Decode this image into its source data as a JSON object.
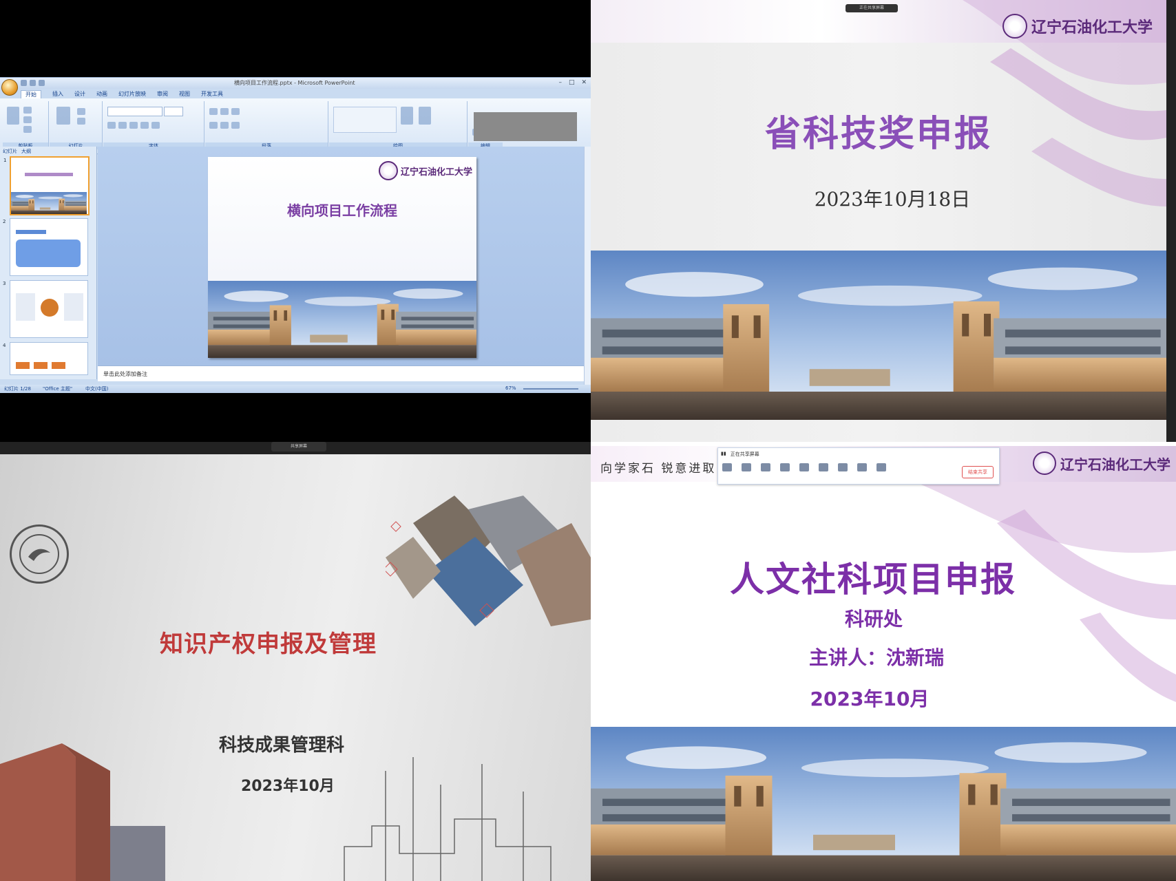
{
  "ppt": {
    "window_title": "横向项目工作流程.pptx - Microsoft PowerPoint",
    "ribbon_tabs": [
      "开始",
      "插入",
      "设计",
      "动画",
      "幻灯片放映",
      "审阅",
      "视图",
      "开发工具"
    ],
    "ribbon_groups": [
      "剪贴板",
      "幻灯片",
      "字体",
      "段落",
      "绘图",
      "编辑"
    ],
    "pane_tabs": [
      "幻灯片",
      "大纲"
    ],
    "slide_title": "横向项目工作流程",
    "university_logo": "辽宁石油化工大学",
    "notes_placeholder": "单击此处添加备注",
    "status_left": "幻灯片 1/28",
    "status_mid": "\"Office 主题\"",
    "status_lang": "中文(中国)",
    "zoom": "67%",
    "thumb_numbers": [
      "1",
      "2",
      "3",
      "4"
    ]
  },
  "slide2": {
    "title": "省科技奖申报",
    "date": "2023年10月18日",
    "university_logo": "辽宁石油化工大学",
    "top_pill": "正在共享屏幕"
  },
  "slide3": {
    "title": "知识产权申报及管理",
    "subtitle": "科技成果管理科",
    "date": "2023年10月",
    "top_pill": "共享屏幕"
  },
  "slide4": {
    "motto": "向学家石 锐意进取",
    "university_logo": "辽宁石油化工大学",
    "title": "人文社科项目申报",
    "department": "科研处",
    "speaker": "主讲人：沈新瑞",
    "date": "2023年10月",
    "toolbar_status": "正在共享屏幕",
    "toolbar_stop": "结束共享"
  },
  "colors": {
    "purple_title": "#8a4fb8",
    "purple_dark": "#7c2fa8",
    "red_title": "#c03a3a",
    "ppt_blue": "#c9dbf1"
  }
}
